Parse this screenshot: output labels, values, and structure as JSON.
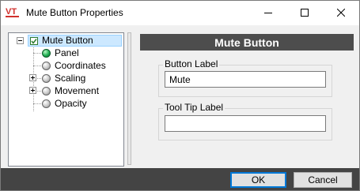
{
  "window": {
    "title": "Mute Button Properties",
    "app_icon": "vt-logo-icon",
    "controls": [
      "minimize-icon",
      "maximize-icon",
      "close-icon"
    ]
  },
  "tree": {
    "root": {
      "label": "Mute Button",
      "selected": true,
      "icon": "checkbox-icon"
    },
    "nodes": [
      {
        "label": "Panel",
        "icon": "green-ball-icon",
        "expandable": false,
        "active": true
      },
      {
        "label": "Coordinates",
        "icon": "gray-ball-icon",
        "expandable": false
      },
      {
        "label": "Scaling",
        "icon": "gray-ball-icon",
        "expandable": true
      },
      {
        "label": "Movement",
        "icon": "gray-ball-icon",
        "expandable": true
      },
      {
        "label": "Opacity",
        "icon": "gray-ball-icon",
        "expandable": false
      }
    ]
  },
  "panel": {
    "header": "Mute Button",
    "button_label": {
      "caption": "Button Label",
      "value": "Mute"
    },
    "tooltip_label": {
      "caption": "Tool Tip Label",
      "value": ""
    }
  },
  "buttons": {
    "ok": "OK",
    "cancel": "Cancel"
  },
  "colors": {
    "accent": "#0078d7",
    "selection": "#cce8ff",
    "header_bg": "#4d4d4d",
    "footer_bg": "#444444"
  }
}
